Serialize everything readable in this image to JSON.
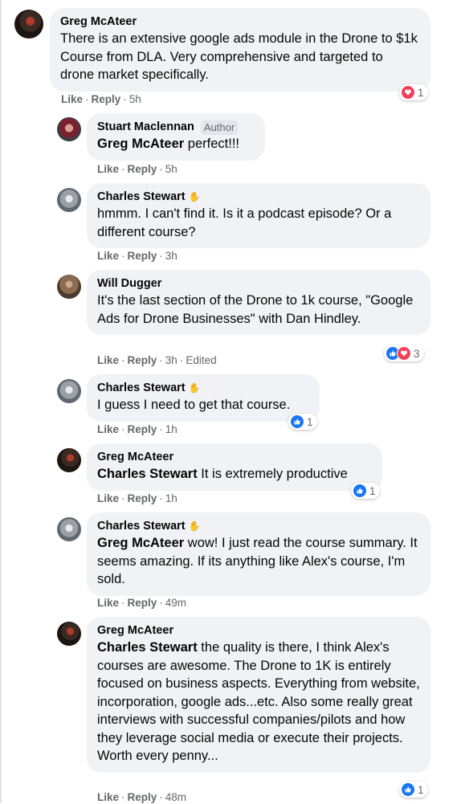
{
  "thread": {
    "comments": [
      {
        "author": "Greg McAteer",
        "text": "There is an extensive google ads module in the Drone to $1k Course from DLA. Very comprehensive and targeted to drone market specifically.",
        "like": "Like",
        "reply": "Reply",
        "time": "5h",
        "reactions": {
          "icons": [
            "love-icon"
          ],
          "count": "1"
        }
      },
      {
        "author": "Stuart Maclennan",
        "badge": "Author",
        "mention": "Greg McAteer",
        "text": " perfect!!!",
        "like": "Like",
        "reply": "Reply",
        "time": "5h"
      },
      {
        "author": "Charles Stewart",
        "name_icon": "wave-icon",
        "text": "hmmm. I can't find it. Is it a podcast episode? Or a different course?",
        "like": "Like",
        "reply": "Reply",
        "time": "3h"
      },
      {
        "author": "Will Dugger",
        "text": "It's the last section of the Drone to 1k course, \"Google Ads for Drone Businesses\" with Dan Hindley.",
        "like": "Like",
        "reply": "Reply",
        "time": "3h",
        "edited": "Edited",
        "reactions": {
          "icons": [
            "like-icon",
            "love-icon"
          ],
          "count": "3"
        }
      },
      {
        "author": "Charles Stewart",
        "name_icon": "wave-icon",
        "text": "I guess I need to get that course.",
        "like": "Like",
        "reply": "Reply",
        "time": "1h",
        "reactions": {
          "icons": [
            "like-icon"
          ],
          "count": "1"
        }
      },
      {
        "author": "Greg McAteer",
        "mention": "Charles Stewart",
        "text": " It is extremely productive",
        "like": "Like",
        "reply": "Reply",
        "time": "1h",
        "reactions": {
          "icons": [
            "like-icon"
          ],
          "count": "1"
        }
      },
      {
        "author": "Charles Stewart",
        "name_icon": "wave-icon",
        "mention": "Greg McAteer",
        "text": " wow! I just read the course summary. It seems amazing. If its anything like Alex's course, I'm sold.",
        "like": "Like",
        "reply": "Reply",
        "time": "49m"
      },
      {
        "author": "Greg McAteer",
        "mention": "Charles Stewart",
        "text": " the quality is there, I think Alex's courses are awesome. The Drone to 1K is entirely focused on business aspects. Everything from website, incorporation, google ads...etc. Also some really great interviews with successful companies/pilots and how they leverage social media or execute their projects. Worth every penny...",
        "like": "Like",
        "reply": "Reply",
        "time": "48m",
        "reactions": {
          "icons": [
            "like-icon"
          ],
          "count": "1"
        }
      }
    ]
  },
  "colors": {
    "like": "#1877f2",
    "love": "#f33e58",
    "bubble": "#f0f2f5",
    "meta": "#65676b"
  }
}
